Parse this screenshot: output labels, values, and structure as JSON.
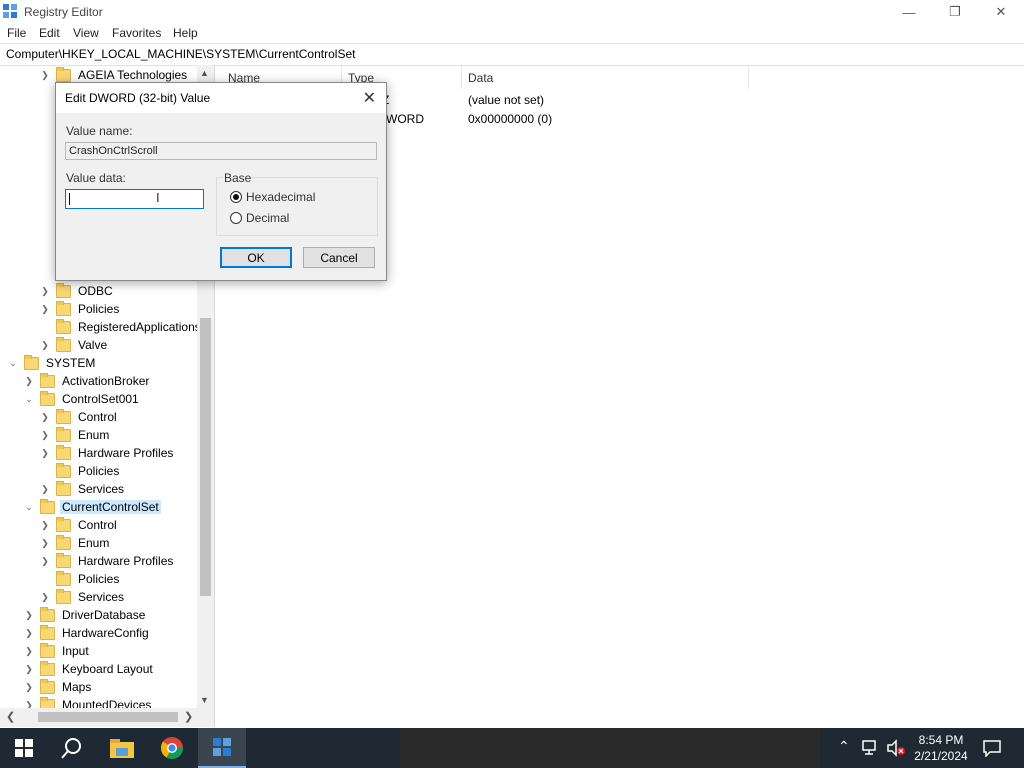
{
  "window": {
    "title": "Registry Editor"
  },
  "menu": [
    "File",
    "Edit",
    "View",
    "Favorites",
    "Help"
  ],
  "address": "Computer\\HKEY_LOCAL_MACHINE\\SYSTEM\\CurrentControlSet",
  "tree": [
    {
      "label": "AGEIA Technologies"
    },
    {
      "label": "ODBC"
    },
    {
      "label": "Policies"
    },
    {
      "label": "RegisteredApplications"
    },
    {
      "label": "Valve"
    },
    {
      "label": "SYSTEM"
    },
    {
      "label": "ActivationBroker"
    },
    {
      "label": "ControlSet001"
    },
    {
      "label": "Control"
    },
    {
      "label": "Enum"
    },
    {
      "label": "Hardware Profiles"
    },
    {
      "label": "Policies"
    },
    {
      "label": "Services"
    },
    {
      "label": "CurrentControlSet"
    },
    {
      "label": "Control"
    },
    {
      "label": "Enum"
    },
    {
      "label": "Hardware Profiles"
    },
    {
      "label": "Policies"
    },
    {
      "label": "Services"
    },
    {
      "label": "DriverDatabase"
    },
    {
      "label": "HardwareConfig"
    },
    {
      "label": "Input"
    },
    {
      "label": "Keyboard Layout"
    },
    {
      "label": "Maps"
    },
    {
      "label": "MountedDevices"
    }
  ],
  "list": {
    "columns": [
      "Name",
      "Type",
      "Data"
    ],
    "rows": [
      {
        "type_partial": "Z",
        "data": "(value not set)"
      },
      {
        "type_partial": "WORD",
        "data": "0x00000000 (0)"
      }
    ]
  },
  "dialog": {
    "title": "Edit DWORD (32-bit) Value",
    "value_name_label": "Value name:",
    "value_name": "CrashOnCtrlScroll",
    "value_data_label": "Value data:",
    "value_data": "",
    "base_label": "Base",
    "hex_label": "Hexadecimal",
    "dec_label": "Decimal",
    "ok": "OK",
    "cancel": "Cancel"
  },
  "taskbar": {
    "time": "8:54 PM",
    "date": "2/21/2024"
  }
}
